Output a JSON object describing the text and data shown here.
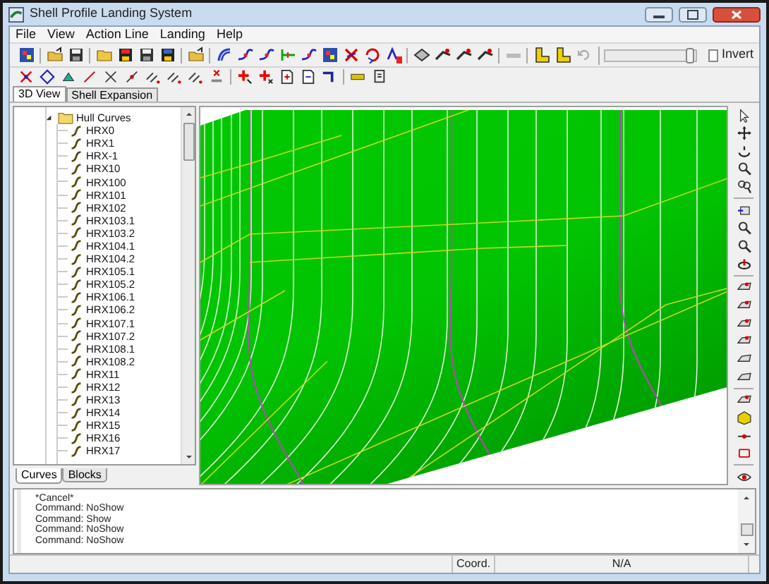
{
  "window": {
    "title": "Shell Profile Landing System"
  },
  "menu": [
    "File",
    "View",
    "Action Line",
    "Landing",
    "Help"
  ],
  "toolbar": {
    "slider": {
      "level": 0.97
    },
    "invert": {
      "label": "Invert",
      "checked": false
    }
  },
  "view_tabs": [
    {
      "label": "3D View",
      "selected": true
    },
    {
      "label": "Shell Expansion",
      "selected": false
    }
  ],
  "tree": [
    {
      "label": "Hull Curves",
      "expanded": true,
      "children": [
        {
          "label": "HRX0"
        },
        {
          "label": "HRX1"
        },
        {
          "label": "HRX-1"
        },
        {
          "label": "HRX10"
        },
        {
          "label": "HRX100"
        },
        {
          "label": "HRX101"
        },
        {
          "label": "HRX102"
        },
        {
          "label": "HRX103.1"
        },
        {
          "label": "HRX103.2"
        },
        {
          "label": "HRX104.1"
        },
        {
          "label": "HRX104.2"
        },
        {
          "label": "HRX105.1"
        },
        {
          "label": "HRX105.2"
        },
        {
          "label": "HRX106.1"
        },
        {
          "label": "HRX106.2"
        },
        {
          "label": "HRX107.1"
        },
        {
          "label": "HRX107.2"
        },
        {
          "label": "HRX108.1"
        },
        {
          "label": "HRX108.2"
        },
        {
          "label": "HRX11"
        },
        {
          "label": "HRX12"
        },
        {
          "label": "HRX13"
        },
        {
          "label": "HRX14"
        },
        {
          "label": "HRX15"
        },
        {
          "label": "HRX16"
        },
        {
          "label": "HRX17"
        }
      ]
    }
  ],
  "panel_tabs": [
    {
      "label": "Curves",
      "selected": true
    },
    {
      "label": "Blocks",
      "selected": false
    }
  ],
  "command_log": [
    "*Cancel*",
    "Command: NoShow",
    "Command: Show",
    "Command: NoShow",
    "Command: NoShow"
  ],
  "status_bar": [
    "Coord.",
    "N/A"
  ]
}
